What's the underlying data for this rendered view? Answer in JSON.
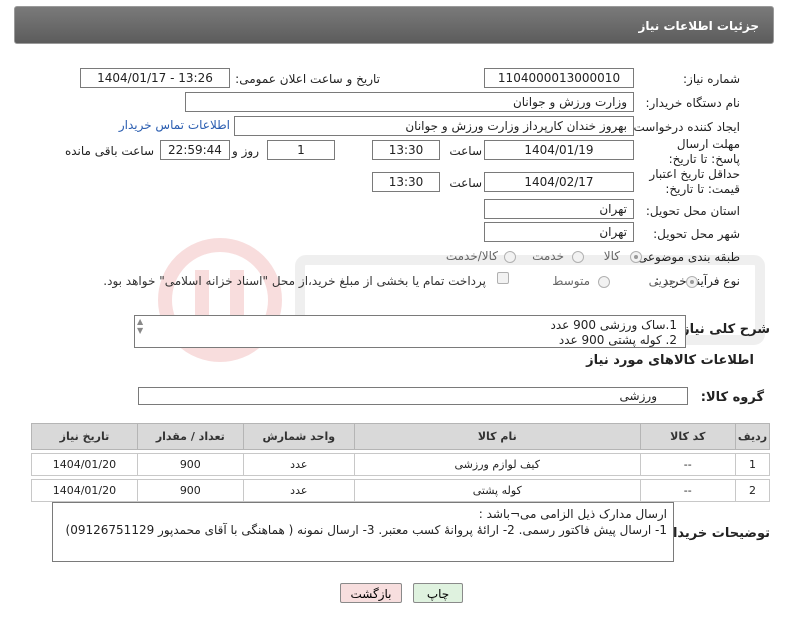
{
  "header": {
    "title": "جزئیات اطلاعات نیاز"
  },
  "fields": {
    "need_number_label": "شماره نیاز:",
    "need_number": "1104000013000010",
    "announce_label": "تاریخ و ساعت اعلان عمومی:",
    "announce_value": "1404/01/17 - 13:26",
    "buyer_org_label": "نام دستگاه خریدار:",
    "buyer_org": "وزارت ورزش و جوانان",
    "creator_label": "ایجاد کننده درخواست:",
    "creator": "بهروز  خندان  کارپرداز وزارت ورزش و جوانان",
    "contact_link": "اطلاعات تماس خریدار",
    "reply_deadline_label": "مهلت ارسال پاسخ: تا تاریخ:",
    "reply_date": "1404/01/19",
    "time_label": "ساعت",
    "reply_time": "13:30",
    "days_value": "1",
    "days_label": "روز و",
    "remaining_value": "22:59:44",
    "remaining_label": "ساعت باقی مانده",
    "price_deadline_label": "حداقل تاریخ اعتبار قیمت: تا تاریخ:",
    "price_date": "1404/02/17",
    "price_time": "13:30",
    "province_label": "استان محل تحویل:",
    "province": "تهران",
    "city_label": "شهر محل تحویل:",
    "city": "تهران",
    "category_label": "طبقه بندی موضوعی:",
    "category_options": [
      "کالا",
      "خدمت",
      "کالا/خدمت"
    ],
    "process_label": "نوع فرآیند خرید :",
    "process_options": [
      "جزیی",
      "متوسط"
    ],
    "payment_note": "پرداخت تمام یا بخشی از مبلغ خرید،از محل \"اسناد خزانه اسلامی\" خواهد بود."
  },
  "description": {
    "label": "شرح کلی نیاز:",
    "lines": [
      "1.ساک ورزشی 900 عدد",
      "2. کوله پشتی 900 عدد"
    ]
  },
  "items_section": {
    "title": "اطلاعات کالاهای مورد نیاز",
    "group_label": "گروه کالا:",
    "group_value": "ورزشی"
  },
  "table": {
    "headers": [
      "ردیف",
      "کد کالا",
      "نام کالا",
      "واحد شمارش",
      "تعداد / مقدار",
      "تاریخ نیاز"
    ],
    "rows": [
      [
        "1",
        "--",
        "کیف لوازم ورزشی",
        "عدد",
        "900",
        "1404/01/20"
      ],
      [
        "2",
        "--",
        "کوله پشتی",
        "عدد",
        "900",
        "1404/01/20"
      ]
    ]
  },
  "notes": {
    "label": "توضیحات خریدار:",
    "line1": "ارسال مدارک ذیل الزامی می¬باشد :",
    "line2": "1- ارسال پیش فاکتور رسمی. 2- ارائۀ پروانۀ کسب معتبر. 3- ارسال نمونه ( هماهنگی با آقای محمدپور 09126751129)"
  },
  "buttons": {
    "print": "چاپ",
    "back": "بازگشت"
  },
  "colors": {
    "header_bg": "#6b6b6b",
    "link": "#2a5db0",
    "print_bg": "#dff2df",
    "back_bg": "#f7dede"
  }
}
